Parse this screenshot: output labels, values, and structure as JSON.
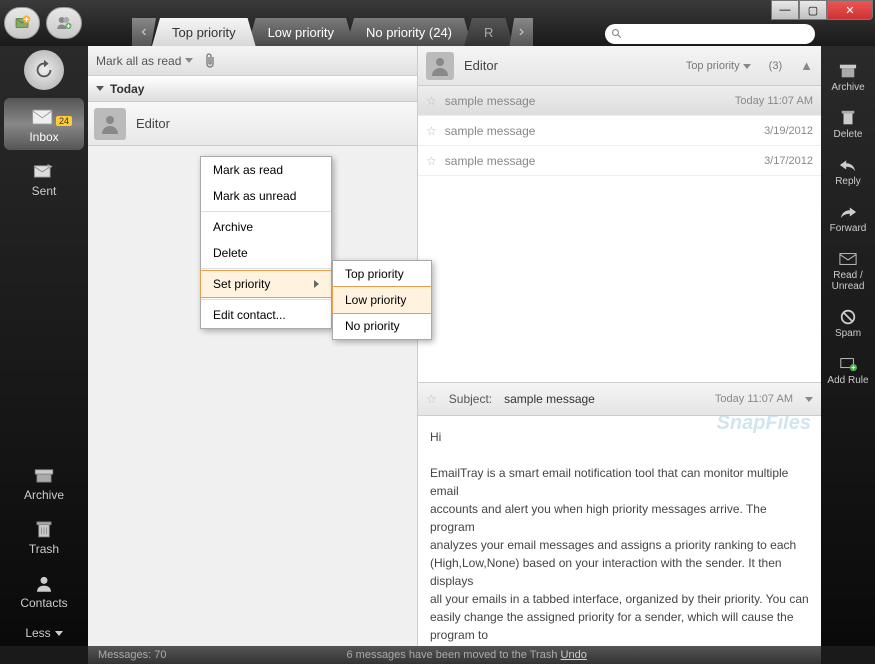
{
  "tabs": {
    "items": [
      "Top priority",
      "Low priority",
      "No priority (24)",
      "R"
    ],
    "active_index": 0
  },
  "sidebar_left": {
    "inbox": "Inbox",
    "inbox_badge": "24",
    "sent": "Sent",
    "archive": "Archive",
    "trash": "Trash",
    "contacts": "Contacts",
    "less": "Less"
  },
  "sidebar_right": {
    "archive": "Archive",
    "delete": "Delete",
    "reply": "Reply",
    "forward": "Forward",
    "read_unread": "Read / Unread",
    "spam": "Spam",
    "add_rule": "Add Rule"
  },
  "toolbar": {
    "mark_all": "Mark all as read"
  },
  "list": {
    "section": "Today",
    "sender": "Editor"
  },
  "thread": {
    "sender": "Editor",
    "priority_label": "Top priority",
    "count": "(3)",
    "messages": [
      {
        "subject": "sample message",
        "date": "Today 11:07 AM"
      },
      {
        "subject": "sample message",
        "date": "3/19/2012"
      },
      {
        "subject": "sample message",
        "date": "3/17/2012"
      }
    ]
  },
  "preview": {
    "subject_label": "Subject:",
    "subject": "sample message",
    "date": "Today 11:07 AM",
    "body": "Hi\n\nEmailTray is a smart email notification tool that can monitor multiple email\naccounts and alert you when high priority messages arrive. The program\nanalyzes your email messages and assigns a priority ranking to each\n(High,Low,None) based on your interaction with the sender. It then displays\nall your emails in a tabbed interface, organized by their priority. You can\neasily change the assigned priority for a sender, which will cause the program to"
  },
  "context_menu": {
    "mark_read": "Mark as read",
    "mark_unread": "Mark as unread",
    "archive": "Archive",
    "delete": "Delete",
    "set_priority": "Set priority",
    "edit_contact": "Edit contact..."
  },
  "submenu": {
    "top": "Top priority",
    "low": "Low priority",
    "no": "No priority"
  },
  "statusbar": {
    "messages": "Messages: 70",
    "moved": "6 messages have been moved to the Trash",
    "undo": "Undo"
  },
  "watermark": "SnapFiles"
}
